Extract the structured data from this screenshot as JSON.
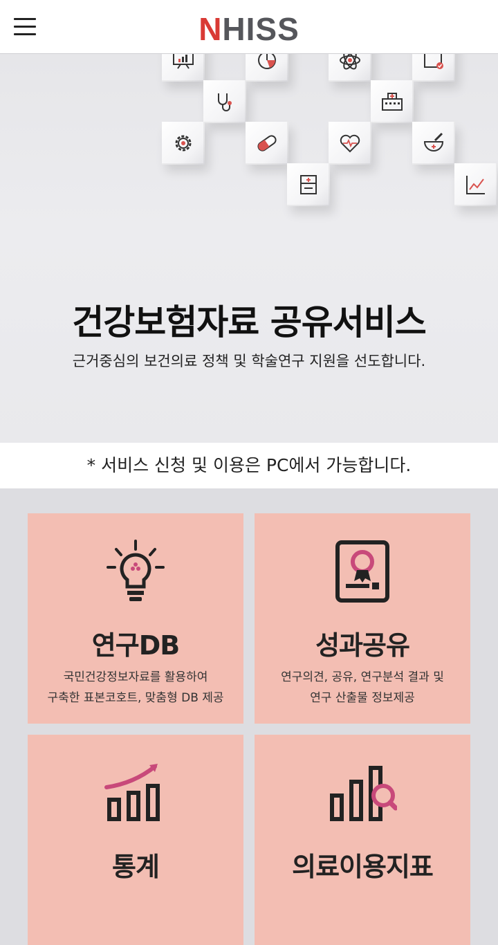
{
  "header": {
    "logo_first": "N",
    "logo_rest": "HISS",
    "menu_icon": "hamburger-menu-icon"
  },
  "hero": {
    "title": "건강보험자료 공유서비스",
    "subtitle": "근거중심의 보건의료 정책 및 학술연구 지원을 선도합니다.",
    "icons": [
      "presentation-chart-icon",
      "pie-chart-icon",
      "atom-icon",
      "calendar-check-icon",
      "stethoscope-icon",
      "hospital-icon",
      "gear-icon",
      "pill-capsule-icon",
      "heart-pulse-icon",
      "mortar-pestle-icon",
      "medical-cabinet-icon",
      "line-chart-icon"
    ]
  },
  "notice": "* 서비스 신청 및 이용은 PC에서 가능합니다.",
  "cards": [
    {
      "title": "연구DB",
      "desc_line1": "국민건강정보자료를 활용하여",
      "desc_line2": "구축한 표본코호트, 맞춤형 DB 제공",
      "icon": "lightbulb-icon"
    },
    {
      "title": "성과공유",
      "desc_line1": "연구의견, 공유, 연구분석 결과 및",
      "desc_line2": "연구 산출물 정보제공",
      "icon": "certificate-award-icon"
    },
    {
      "title": "통계",
      "icon": "bar-chart-trend-icon"
    },
    {
      "title": "의료이용지표",
      "icon": "bar-chart-search-icon"
    }
  ],
  "colors": {
    "accent": "#d93a35",
    "card_bg": "#f3beb3",
    "icon_pink": "#c8497a"
  }
}
